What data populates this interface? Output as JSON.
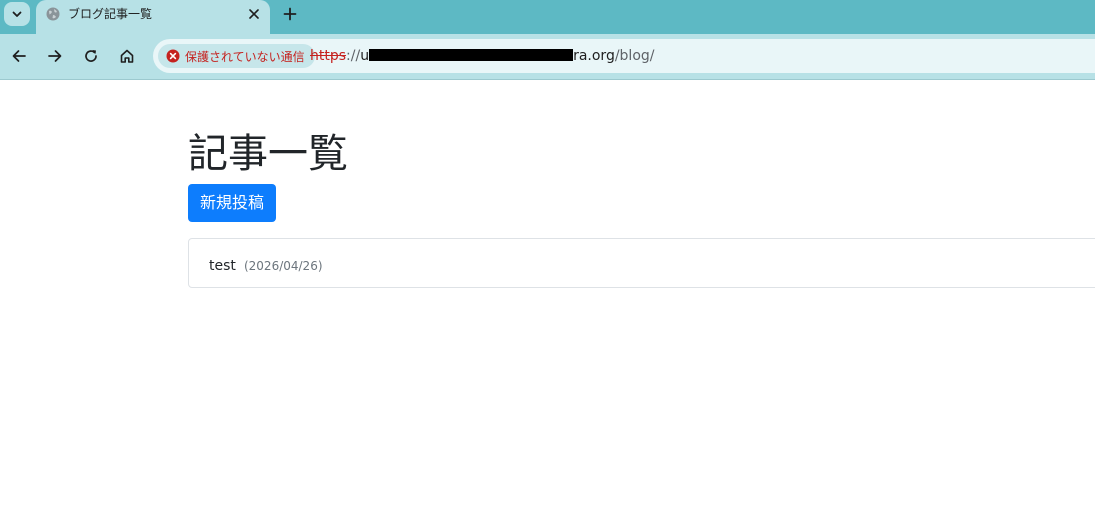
{
  "browser": {
    "tab": {
      "title": "ブログ記事一覧"
    },
    "address_bar": {
      "security_label": "保護されていない通信",
      "url_scheme": "https",
      "url_separator": "://",
      "url_host_start": "u",
      "url_host_end": "ra.org",
      "url_path": "/blog/"
    }
  },
  "page": {
    "title": "記事一覧",
    "new_post_label": "新規投稿",
    "posts": [
      {
        "title": "test",
        "date": "(2026/04/26)"
      }
    ]
  },
  "colors": {
    "tabstrip": "#5db9c4",
    "toolbar": "#b7e1e6",
    "insecure": "#c5221f",
    "primary_button": "#0d7dfd"
  },
  "icons": {
    "tab_search": "chevron-down-icon",
    "favicon": "globe-icon",
    "tab_close": "close-icon",
    "new_tab": "plus-icon",
    "back": "arrow-left-icon",
    "forward": "arrow-right-icon",
    "reload": "reload-icon",
    "home": "home-icon",
    "security": "error-circle-icon"
  }
}
